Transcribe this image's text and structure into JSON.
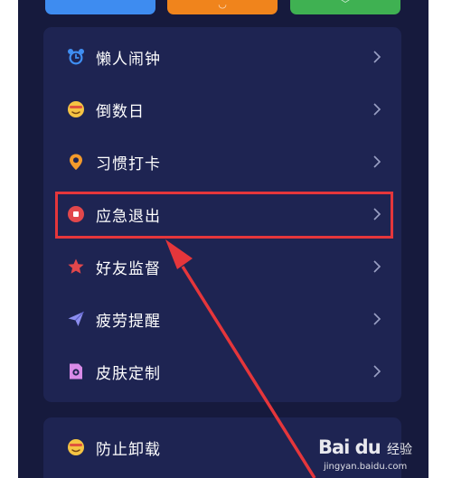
{
  "menu": {
    "items": [
      {
        "label": "懒人闹钟",
        "icon": "alarm-clock-icon"
      },
      {
        "label": "倒数日",
        "icon": "emoji-face-icon"
      },
      {
        "label": "习惯打卡",
        "icon": "location-pin-icon"
      },
      {
        "label": "应急退出",
        "icon": "record-stop-icon"
      },
      {
        "label": "好友监督",
        "icon": "star-icon"
      },
      {
        "label": "疲劳提醒",
        "icon": "paper-plane-icon"
      },
      {
        "label": "皮肤定制",
        "icon": "photo-icon"
      }
    ]
  },
  "second_card": {
    "items": [
      {
        "label": "防止卸载",
        "icon": "emoji-face-icon"
      }
    ]
  },
  "annotation": {
    "highlighted_item": "应急退出",
    "color": "#e5363b"
  },
  "watermark": {
    "brand": "Bai du",
    "title": "经验",
    "url": "jingyan.baidu.com"
  },
  "colors": {
    "background": "#161a3d",
    "card": "#1e2452",
    "top_blue": "#3e8cf0",
    "top_orange": "#f0841c",
    "top_green": "#3fb152"
  }
}
